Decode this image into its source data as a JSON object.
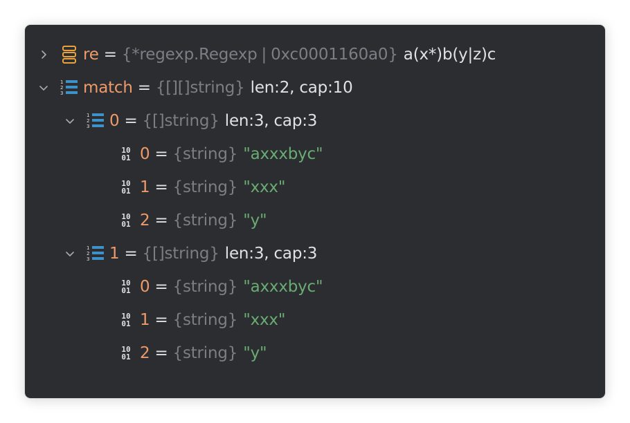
{
  "variables": [
    {
      "id": "re",
      "name": "re",
      "type": "{*regexp.Regexp",
      "separator": "|",
      "address": "0xc0001160a0}",
      "value": "a(x*)b(y|z)c",
      "expanded": false
    },
    {
      "id": "match",
      "name": "match",
      "type": "{[][]string}",
      "value": "len:2, cap:10",
      "expanded": true,
      "children": [
        {
          "name": "0",
          "type": "{[]string}",
          "value": "len:3, cap:3",
          "expanded": true,
          "children": [
            {
              "name": "0",
              "type": "{string}",
              "value": "\"axxxbyc\""
            },
            {
              "name": "1",
              "type": "{string}",
              "value": "\"xxx\""
            },
            {
              "name": "2",
              "type": "{string}",
              "value": "\"y\""
            }
          ]
        },
        {
          "name": "1",
          "type": "{[]string}",
          "value": "len:3, cap:3",
          "expanded": true,
          "children": [
            {
              "name": "0",
              "type": "{string}",
              "value": "\"axxxbyc\""
            },
            {
              "name": "1",
              "type": "{string}",
              "value": "\"xxx\""
            },
            {
              "name": "2",
              "type": "{string}",
              "value": "\"y\""
            }
          ]
        }
      ]
    }
  ],
  "icons": {
    "collapsed": "chevron-right-icon",
    "expanded": "chevron-down-icon",
    "struct": "struct-icon",
    "array": "array-icon",
    "string": "binary-icon",
    "binary_top": "10",
    "binary_bottom": "01"
  },
  "colors": {
    "background": "#2b2d30",
    "name": "#ef9a6b",
    "type": "#7b7e85",
    "string_value": "#6aab73",
    "text": "#dfe1e5",
    "struct_icon": "#e8a33d",
    "array_icon": "#3d93c9"
  }
}
